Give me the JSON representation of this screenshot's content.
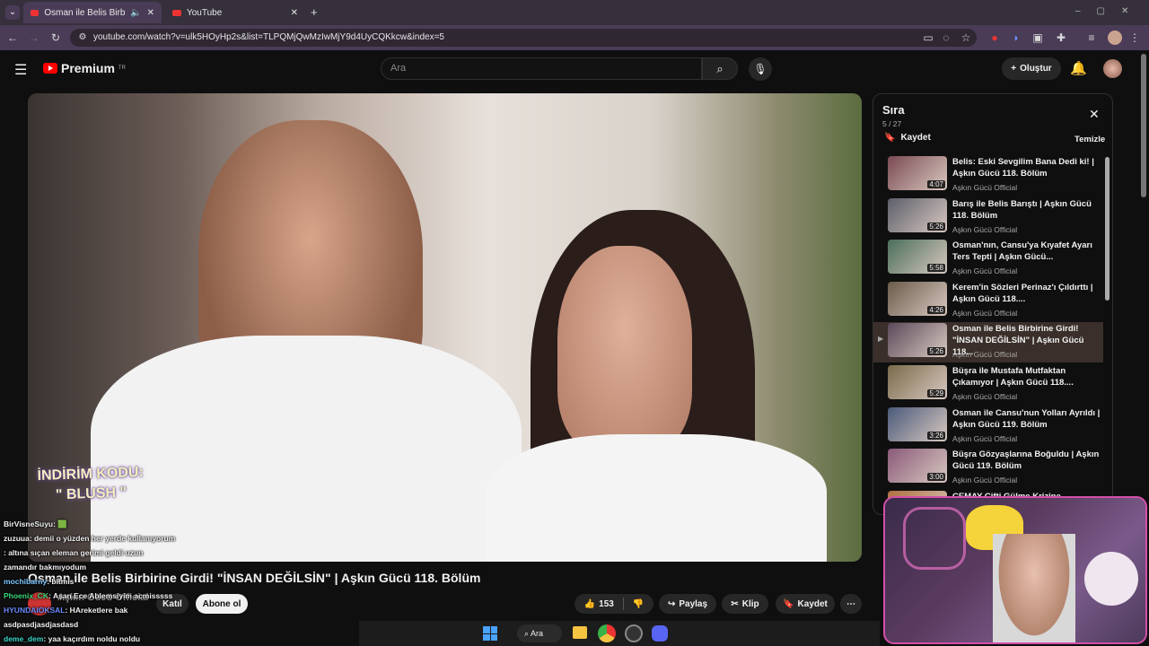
{
  "browser": {
    "tabs": [
      {
        "title": "Osman ile Belis Birbirine Gir"
      },
      {
        "title": "YouTube"
      }
    ],
    "url": "youtube.com/watch?v=ulk5HOyHp2s&list=TLPQMjQwMzIwMjY9d4UyCQKkcw&index=5"
  },
  "header": {
    "logo": "Premium",
    "region": "TR",
    "search_placeholder": "Ara",
    "create_label": "Oluştur"
  },
  "video": {
    "title": "Osman ile Belis Birbirine Girdi! \"İNSAN DEĞİLSİN\" | Aşkın Gücü 118. Bölüm",
    "promo_line1": "İNDİRİM KODU:",
    "promo_line2": "\" BLUSH \"",
    "channel": "Aşkın Gücü Official",
    "join_label": "Katıl",
    "subscribe_label": "Abone ol",
    "likes": "153",
    "share_label": "Paylaş",
    "clip_label": "Klip",
    "save_label": "Kaydet"
  },
  "queue": {
    "title": "Sıra",
    "position": "5 / 27",
    "save_label": "Kaydet",
    "clear_label": "Temizle",
    "items": [
      {
        "title": "Belis: Eski Sevgilim Bana Dedi ki! | Aşkın Gücü 118. Bölüm",
        "channel": "Aşkın Gücü Official",
        "duration": "4:07"
      },
      {
        "title": "Barış ile Belis Barıştı | Aşkın Gücü 118. Bölüm",
        "channel": "Aşkın Gücü Official",
        "duration": "5:26"
      },
      {
        "title": "Osman'nın, Cansu'ya Kıyafet Ayarı Ters Tepti | Aşkın Gücü...",
        "channel": "Aşkın Gücü Official",
        "duration": "5:58"
      },
      {
        "title": "Kerem'in Sözleri Perinaz'ı Çıldırttı | Aşkın Gücü 118....",
        "channel": "Aşkın Gücü Official",
        "duration": "4:26"
      },
      {
        "title": "Osman ile Belis Birbirine Girdi! \"İNSAN DEĞİLSİN\" | Aşkın Gücü 118...",
        "channel": "Aşkın Gücü Official",
        "duration": "5:26"
      },
      {
        "title": "Büşra ile Mustafa Mutfaktan Çıkamıyor | Aşkın Gücü 118....",
        "channel": "Aşkın Gücü Official",
        "duration": "5:29"
      },
      {
        "title": "Osman ile Cansu'nun Yolları Ayrıldı | Aşkın Gücü 119. Bölüm",
        "channel": "Aşkın Gücü Official",
        "duration": "3:26"
      },
      {
        "title": "Büşra Gözyaşlarına Boğuldu | Aşkın Gücü 119. Bölüm",
        "channel": "Aşkın Gücü Official",
        "duration": "3:00"
      },
      {
        "title": "CEMAY Çifti Gülme Krizine...",
        "channel": "",
        "duration": ""
      }
    ]
  },
  "chat": [
    {
      "user": "BirVisneSuyu",
      "msg": ": 🟩",
      "color": "#f1f1f1"
    },
    {
      "user": "zuzuua",
      "msg": ": demii o yüzden her yerde kullanıyorum",
      "color": "#f1f1f1"
    },
    {
      "user": "",
      "msg": ": altına sıçan eleman gerimi geldi uzun",
      "color": "#d33"
    },
    {
      "user": "",
      "msg": "zamandır bakmıyodum",
      "color": "#f1f1f1"
    },
    {
      "user": "mochibarny",
      "msg": ": bitmis",
      "color": "#7cc7ff"
    },
    {
      "user": "Phoenix_CK",
      "msg": ": Aşan Ece Ablemsiyim acmisssss",
      "color": "#3ad87a"
    },
    {
      "user": "HYUNDAIOKSAL",
      "msg": ": HAreketlere bak",
      "color": "#6b8cff"
    },
    {
      "user": "",
      "msg": "asdpasdjasdjasdasd",
      "color": "#f1f1f1"
    },
    {
      "user": "deme_dem",
      "msg": ": yaa kaçırdım noldu noldu",
      "color": "#3ad8c8"
    }
  ],
  "taskbar": {
    "search_label": "Ara"
  },
  "colors": {
    "accent_red": "#ff0000",
    "tab_bg": "#4a3c57",
    "webcam_border": "#d34fa8"
  }
}
